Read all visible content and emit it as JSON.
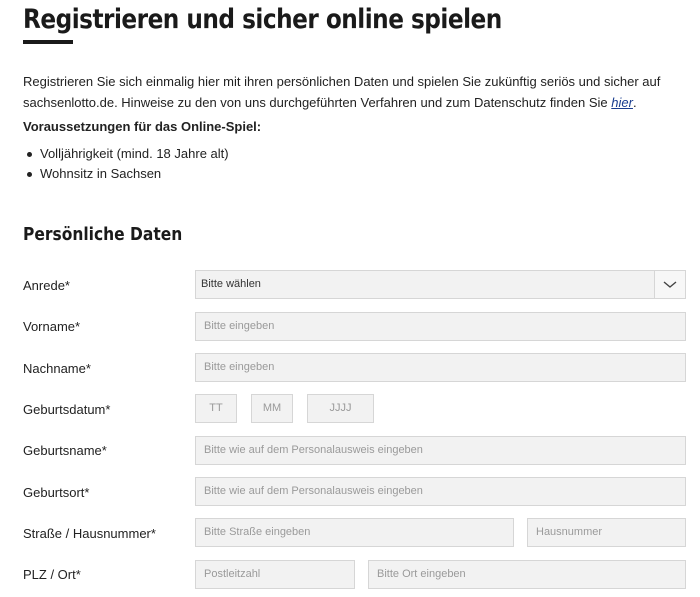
{
  "page": {
    "title": "Registrieren und sicher online spielen",
    "intro_text": "Registrieren Sie sich einmalig hier mit ihren persönlichen Daten und spielen Sie zukünftig seriös und sicher auf sachsenlotto.de. Hinweise zu den von uns durchgeführten Verfahren und zum Datenschutz finden Sie ",
    "intro_link": "hier",
    "intro_end": ".",
    "requirements_title": "Voraussetzungen für das Online-Spiel:",
    "requirements": [
      "Volljährigkeit (mind. 18 Jahre alt)",
      "Wohnsitz in Sachsen"
    ]
  },
  "form": {
    "section_title": "Persönliche Daten",
    "anrede": {
      "label": "Anrede*",
      "value": "Bitte wählen"
    },
    "vorname": {
      "label": "Vorname*",
      "placeholder": "Bitte eingeben"
    },
    "nachname": {
      "label": "Nachname*",
      "placeholder": "Bitte eingeben"
    },
    "geburtsdatum": {
      "label": "Geburtsdatum*",
      "day": "TT",
      "month": "MM",
      "year": "JJJJ"
    },
    "geburtsname": {
      "label": "Geburtsname*",
      "placeholder": "Bitte wie auf dem Personalausweis eingeben"
    },
    "geburtsort": {
      "label": "Geburtsort*",
      "placeholder": "Bitte wie auf dem Personalausweis eingeben"
    },
    "strasse": {
      "label": "Straße / Hausnummer*",
      "street_placeholder": "Bitte Straße eingeben",
      "number_placeholder": "Hausnummer"
    },
    "plz_ort": {
      "label": "PLZ / Ort*",
      "plz_placeholder": "Postleitzahl",
      "ort_placeholder": "Bitte Ort eingeben"
    }
  }
}
